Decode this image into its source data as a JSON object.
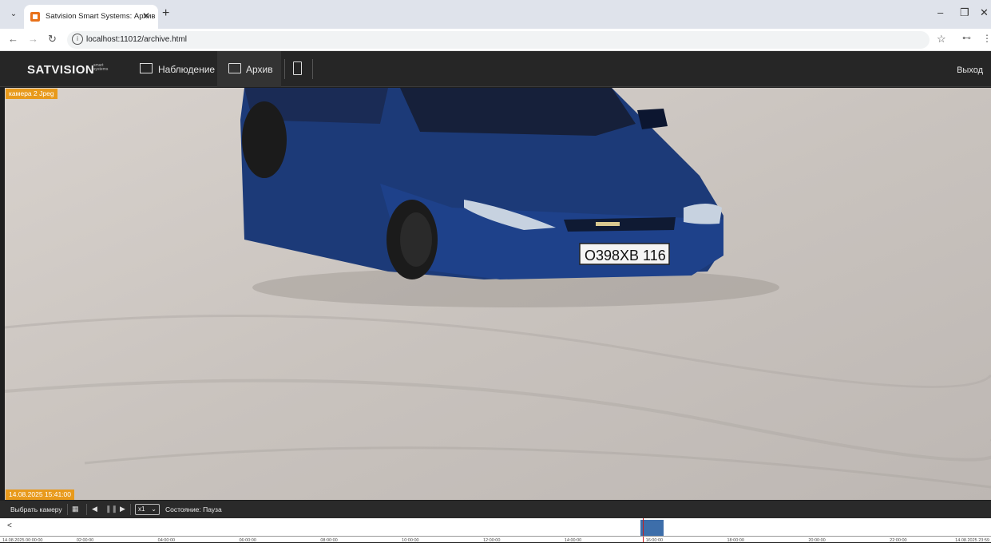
{
  "browser": {
    "tab_title": "Satvision Smart Systems: Архив",
    "tab_close": "✕",
    "new_tab": "+",
    "url": "localhost:11012/archive.html",
    "window_minimize": "–",
    "window_restore": "❐",
    "window_close": "✕"
  },
  "app": {
    "logo": "SATVISION",
    "logo_sub_1": "smart",
    "logo_sub_2": "systems",
    "nav": [
      {
        "label": "Наблюдение",
        "icon": "monitor-icon"
      },
      {
        "label": "Архив",
        "icon": "folder-icon"
      },
      {
        "label": "",
        "icon": "tablet-icon"
      }
    ],
    "logout": "Выход"
  },
  "video": {
    "camera_label": "камера 2 Jpeg",
    "timestamp": "14.08.2025 15:41:00",
    "plate": "O398XB 116"
  },
  "controls": {
    "select_camera": "Выбрать камеру",
    "speed": "x1",
    "status": "Состояние: Пауза"
  },
  "timeline": {
    "back": "<",
    "ticks": [
      "14.08.2025 00:00:00",
      "02:00:00",
      "04:00:00",
      "06:00:00",
      "08:00:00",
      "10:00:00",
      "12:00:00",
      "14:00:00",
      "16:00:00",
      "18:00:00",
      "20:00:00",
      "22:00:00",
      "14.08.2025 23:59"
    ],
    "recording_start": "15:38:00",
    "recording_end": "16:12:00",
    "cursor_time": "15:41:00",
    "colors": {
      "recording": "#3d6eaa",
      "cursor": "#c81e1e",
      "accent": "#e89a1c"
    }
  }
}
